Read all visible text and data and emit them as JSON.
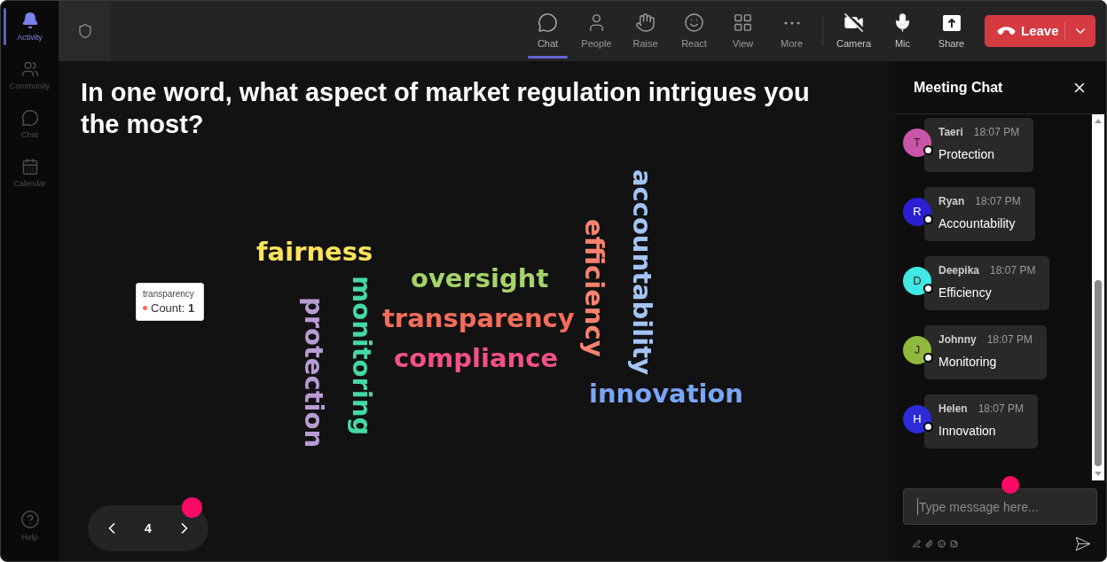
{
  "sidebar": {
    "items": [
      {
        "label": "Activity",
        "selected": true
      },
      {
        "label": "Community",
        "selected": false
      },
      {
        "label": "Chat",
        "selected": false
      },
      {
        "label": "Calendar",
        "selected": false
      }
    ],
    "help": {
      "label": "Help"
    }
  },
  "header": {
    "tools": [
      {
        "label": "Chat",
        "selected": true
      },
      {
        "label": "People",
        "selected": false
      },
      {
        "label": "Raise",
        "selected": false
      },
      {
        "label": "React",
        "selected": false
      },
      {
        "label": "View",
        "selected": false
      },
      {
        "label": "More",
        "selected": false
      }
    ],
    "devices": [
      {
        "label": "Camera"
      },
      {
        "label": "Mic"
      },
      {
        "label": "Share"
      }
    ],
    "leave_button": {
      "label": "Leave"
    }
  },
  "question": {
    "text": "In one word, what aspect of market regulation intrigues you the most?"
  },
  "word_cloud": {
    "words": [
      {
        "text": "accountability",
        "kind": "vertical",
        "color": "#a3c4f4"
      },
      {
        "text": "efficiency",
        "kind": "vertical",
        "color": "#f9826f"
      },
      {
        "text": "fairness",
        "kind": "horizontal",
        "color": "#fde35c"
      },
      {
        "text": "oversight",
        "kind": "horizontal",
        "color": "#a5d46a"
      },
      {
        "text": "monitoring",
        "kind": "vertical",
        "color": "#44d9a4"
      },
      {
        "text": "protection",
        "kind": "vertical",
        "color": "#b99bd4"
      },
      {
        "text": "transparency",
        "kind": "horizontal",
        "color": "#f46d5a"
      },
      {
        "text": "compliance",
        "kind": "horizontal",
        "color": "#f5508a"
      },
      {
        "text": "innovation",
        "kind": "horizontal",
        "color": "#78a6f6"
      }
    ],
    "tooltip": {
      "title": "transparency",
      "count": "Count: **1**",
      "color": "#f46d5a"
    }
  },
  "pager": {
    "page": "4"
  },
  "chat": {
    "title": "Meeting Chat",
    "messages": [
      {
        "initial": "T",
        "author": "Taeri",
        "time": "18:07 PM",
        "text": "Protection",
        "color": "#c955a8"
      },
      {
        "initial": "R",
        "author": "Ryan",
        "time": "18:07 PM",
        "text": "Accountability",
        "color": "#2a1fd1"
      },
      {
        "initial": "D",
        "author": "Deepika",
        "time": "18:07 PM",
        "text": "Efficiency",
        "color": "#40e8e6"
      },
      {
        "initial": "J",
        "author": "Johnny",
        "time": "18:07 PM",
        "text": "Monitoring",
        "color": "#8fb93a"
      },
      {
        "initial": "H",
        "author": "Helen",
        "time": "18:07 PM",
        "text": "Innovation",
        "color": "#2b2bd8"
      }
    ],
    "composer": {
      "placeholder": "Type message here..."
    }
  }
}
